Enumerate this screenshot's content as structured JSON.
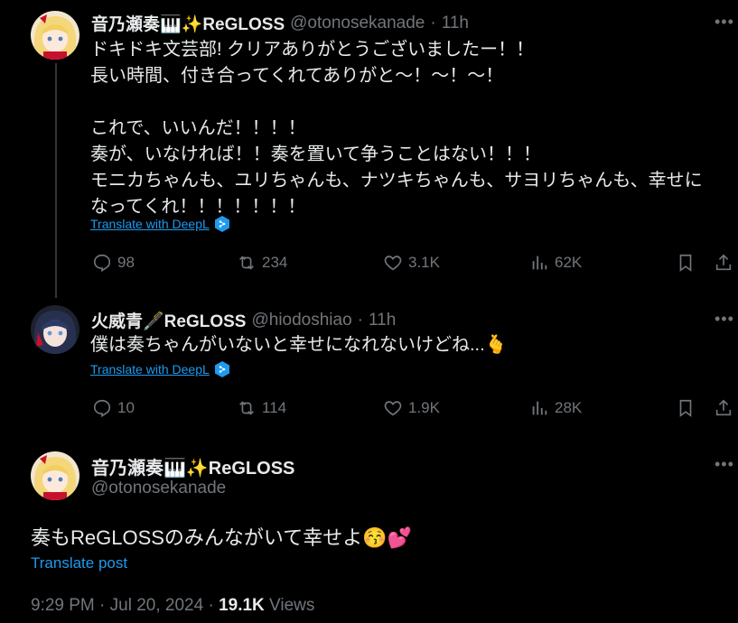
{
  "colors": {
    "background": "#000000",
    "text": "#e7e9ea",
    "muted": "#71767b",
    "link": "#1d9bf0"
  },
  "tweet1": {
    "name": "音乃瀬奏🎹✨ReGLOSS",
    "handle": "@otonosekanade",
    "sep": "·",
    "time": "11h",
    "text": "ドキドキ文芸部! クリアありがとうございましたー！！\n長い時間、付き合ってくれてありがと～！～！～！\n\nこれで、いいんだ！！！！\n奏が、いなければ！！奏を置いて争うことはない！！！\nモニカちゃんも、ユリちゃんも、ナツキちゃんも、サヨリちゃんも、幸せに\nなってくれ！！！！！！！",
    "translate": "Translate with DeepL",
    "replies": "98",
    "reposts": "234",
    "likes": "3.1K",
    "views": "62K"
  },
  "tweet2": {
    "name": "火威青🖋️ReGLOSS",
    "handle": "@hiodoshiao",
    "sep": "·",
    "time": "11h",
    "text": "僕は奏ちゃんがいないと幸せになれないけどね...🫰",
    "translate": "Translate with DeepL",
    "replies": "10",
    "reposts": "114",
    "likes": "1.9K",
    "views": "28K"
  },
  "tweet3": {
    "name": "音乃瀬奏🎹✨ReGLOSS",
    "handle": "@otonosekanade",
    "text": "奏もReGLOSSのみんながいて幸せよ😚💕",
    "translate": "Translate post",
    "time": "9:29 PM · Jul 20, 2024 · ",
    "view_count": "19.1K",
    "views_label": " Views"
  },
  "more_icon": "ellipsis-icon"
}
